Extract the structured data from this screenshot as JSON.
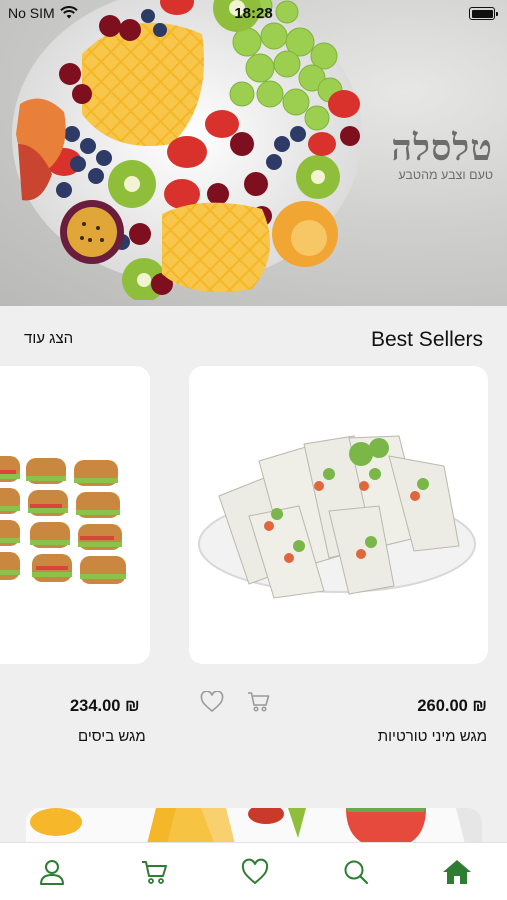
{
  "status_bar": {
    "carrier": "No SIM",
    "time": "18:28"
  },
  "hero": {
    "brand_logo": "טלסלה",
    "brand_tagline": "טעם וצבע מהטבע"
  },
  "best_sellers": {
    "title": "Best Sellers",
    "show_more": "הצג עוד"
  },
  "products": [
    {
      "name": "מגש מיני טורטיות",
      "price": "260.00 ₪"
    },
    {
      "name": "מגש ביסים",
      "price": "234.00 ₪"
    }
  ],
  "tab_bar": {
    "items": [
      "profile-icon",
      "cart-icon",
      "heart-icon",
      "search-icon",
      "home-icon"
    ],
    "active": "home-icon"
  },
  "colors": {
    "accent": "#2e7d32",
    "brand_green": "#5aa832",
    "icon_gray": "#9a9a9a"
  }
}
